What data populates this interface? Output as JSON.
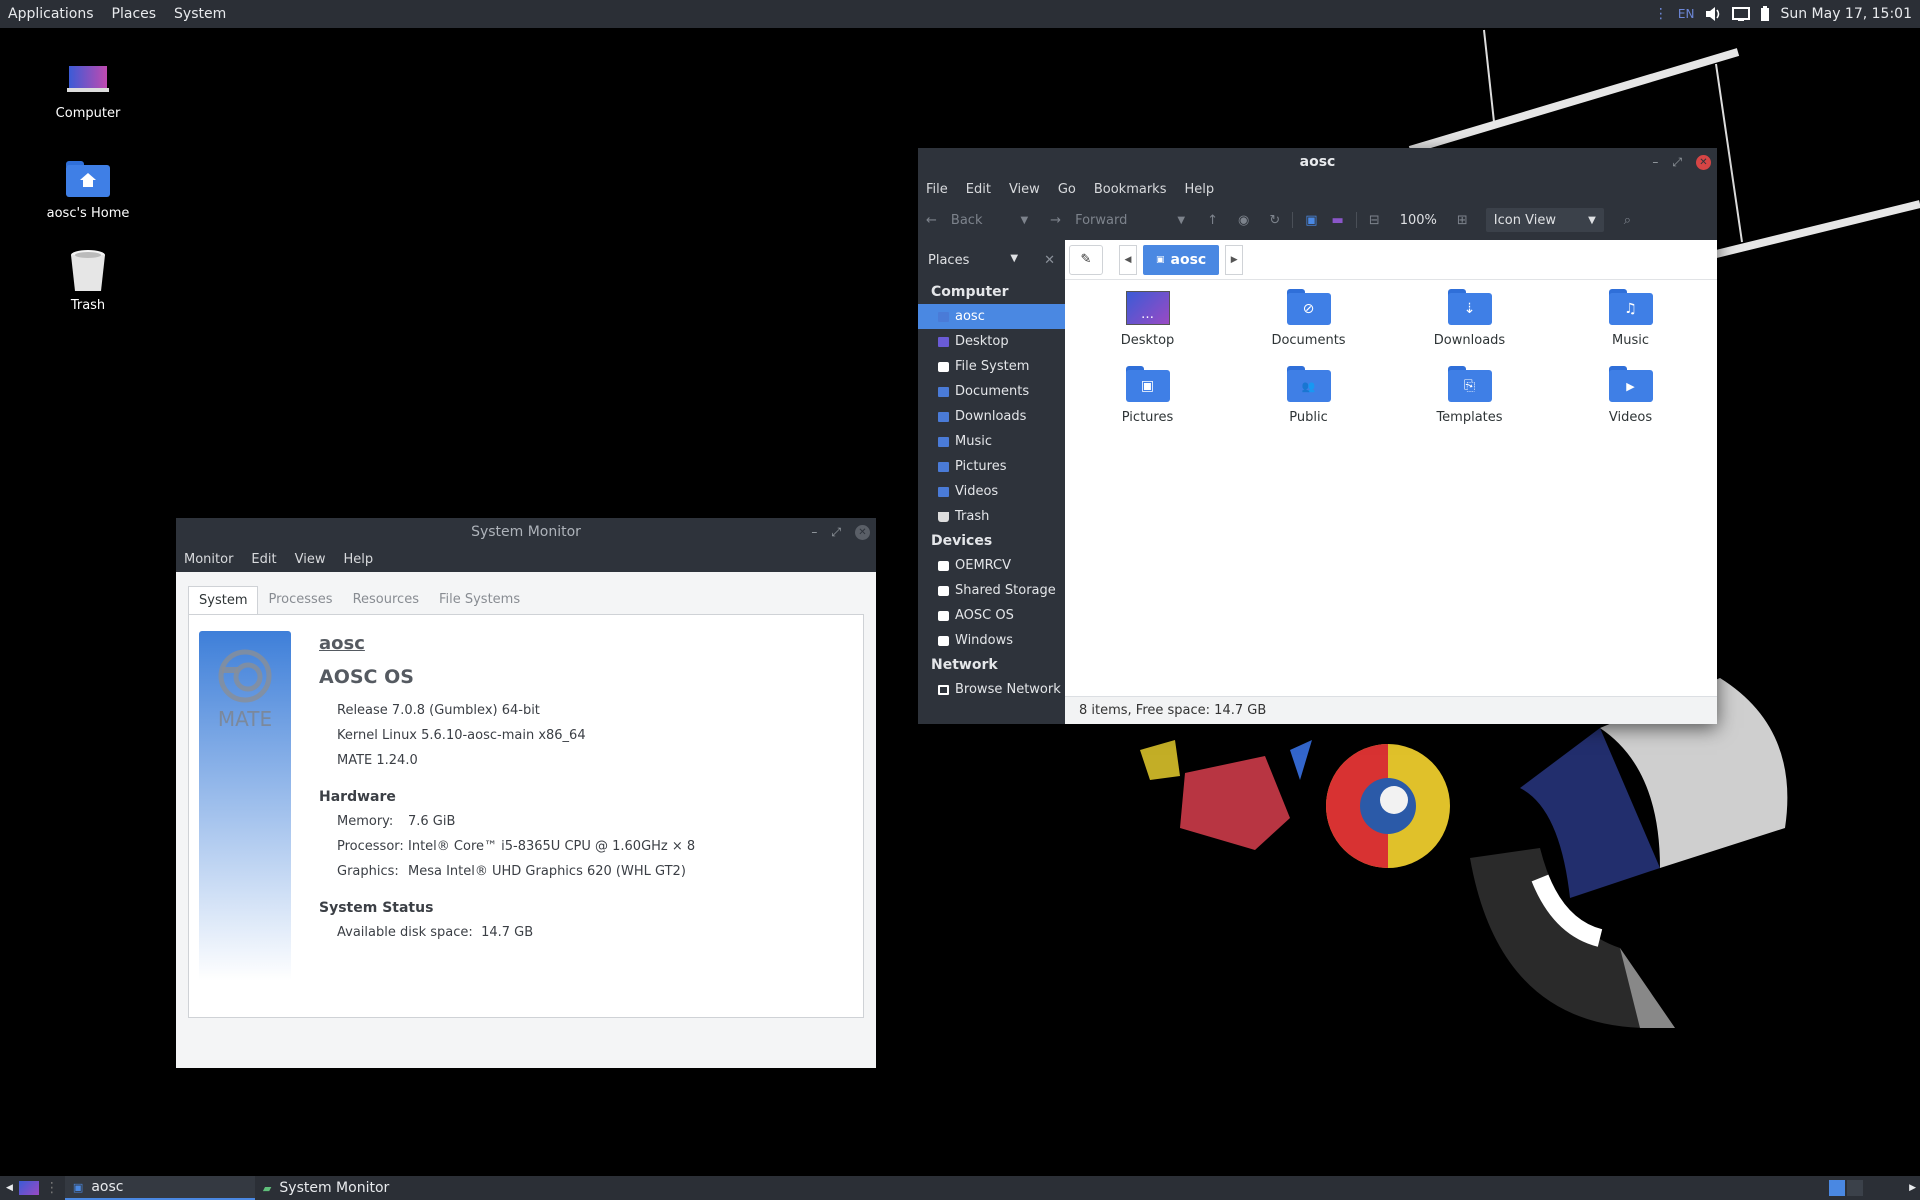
{
  "top_panel": {
    "menus": [
      "Applications",
      "Places",
      "System"
    ],
    "keyboard_layout": "EN",
    "clock": "Sun May 17, 15:01"
  },
  "desktop_icons": [
    {
      "label": "Computer",
      "icon": "computer-icon"
    },
    {
      "label": "aosc's Home",
      "icon": "home-folder-icon"
    },
    {
      "label": "Trash",
      "icon": "trash-icon"
    }
  ],
  "file_manager": {
    "title": "aosc",
    "menu": [
      "File",
      "Edit",
      "View",
      "Go",
      "Bookmarks",
      "Help"
    ],
    "toolbar": {
      "back": "Back",
      "forward": "Forward",
      "zoom": "100%",
      "view_mode": "Icon View"
    },
    "sidebar": {
      "header": "Places",
      "sections": [
        {
          "title": "Computer",
          "items": [
            "aosc",
            "Desktop",
            "File System",
            "Documents",
            "Downloads",
            "Music",
            "Pictures",
            "Videos",
            "Trash"
          ]
        },
        {
          "title": "Devices",
          "items": [
            "OEMRCV",
            "Shared Storage",
            "AOSC OS",
            "Windows"
          ]
        },
        {
          "title": "Network",
          "items": [
            "Browse Network"
          ]
        }
      ],
      "selected": "aosc"
    },
    "path": "aosc",
    "items": [
      {
        "label": "Desktop",
        "glyph": "…"
      },
      {
        "label": "Documents",
        "glyph": "⊘"
      },
      {
        "label": "Downloads",
        "glyph": "⇣"
      },
      {
        "label": "Music",
        "glyph": "♫"
      },
      {
        "label": "Pictures",
        "glyph": "▣"
      },
      {
        "label": "Public",
        "glyph": "👥"
      },
      {
        "label": "Templates",
        "glyph": "⎘"
      },
      {
        "label": "Videos",
        "glyph": "▶"
      }
    ],
    "status": "8 items, Free space: 14.7 GB"
  },
  "system_monitor": {
    "title": "System Monitor",
    "menu": [
      "Monitor",
      "Edit",
      "View",
      "Help"
    ],
    "tabs": [
      "System",
      "Processes",
      "Resources",
      "File Systems"
    ],
    "active_tab": "System",
    "logo_text": "MATE",
    "hostname": "aosc",
    "os_name": "AOSC OS",
    "release": "Release 7.0.8 (Gumblex) 64-bit",
    "kernel": "Kernel Linux 5.6.10-aosc-main x86_64",
    "mate_version": "MATE 1.24.0",
    "hardware_title": "Hardware",
    "memory_label": "Memory:",
    "memory_value": "7.6 GiB",
    "processor_label": "Processor:",
    "processor_value": "Intel® Core™ i5-8365U CPU @ 1.60GHz × 8",
    "graphics_label": "Graphics:",
    "graphics_value": "Mesa Intel® UHD Graphics 620 (WHL GT2)",
    "status_title": "System Status",
    "disk_label": "Available disk space:",
    "disk_value": "14.7 GB"
  },
  "bottom_panel": {
    "tasks": [
      {
        "label": "aosc",
        "active": true
      },
      {
        "label": "System Monitor",
        "active": false
      }
    ]
  },
  "colors": {
    "panel_bg": "#2b2f36",
    "accent": "#4a88e2",
    "folder_blue": "#3f7fe6"
  }
}
